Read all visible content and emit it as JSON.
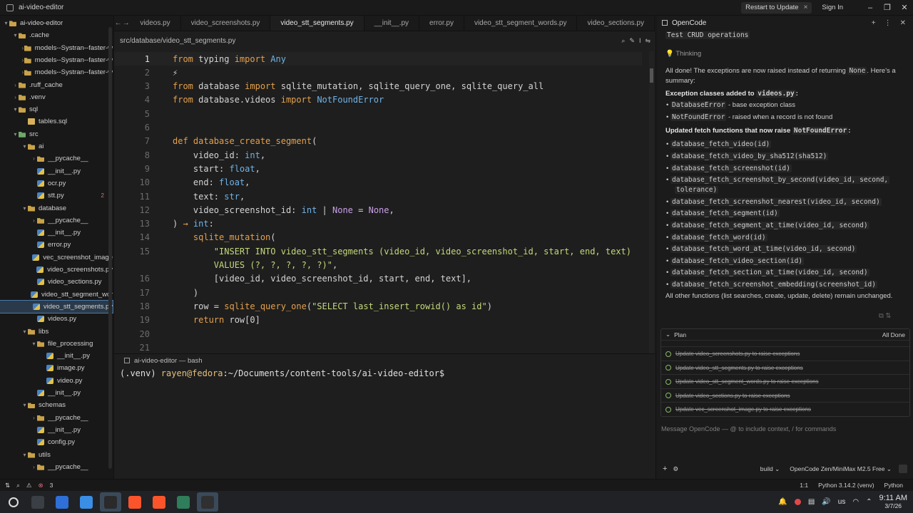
{
  "window": {
    "title": "ai-video-editor",
    "restart_label": "Restart to Update",
    "close_glyph": "×",
    "signin_label": "Sign In",
    "minimize": "–",
    "maximize": "❐",
    "close": "✕"
  },
  "sidebar": {
    "items": [
      {
        "label": "ai-video-editor",
        "icon": "folder",
        "depth": 0,
        "chev": "▾"
      },
      {
        "label": ".cache",
        "icon": "folder",
        "depth": 1,
        "chev": "▾"
      },
      {
        "label": "models--Systran--faster-w",
        "icon": "folder",
        "depth": 2,
        "chev": "›"
      },
      {
        "label": "models--Systran--faster-w",
        "icon": "folder",
        "depth": 2,
        "chev": "›"
      },
      {
        "label": "models--Systran--faster-w",
        "icon": "folder",
        "depth": 2,
        "chev": "›"
      },
      {
        "label": ".ruff_cache",
        "icon": "folder",
        "depth": 1,
        "chev": "›"
      },
      {
        "label": ".venv",
        "icon": "folder",
        "depth": 1,
        "chev": "›"
      },
      {
        "label": "sql",
        "icon": "folder",
        "depth": 1,
        "chev": "▾"
      },
      {
        "label": "tables.sql",
        "icon": "sql",
        "depth": 2,
        "chev": ""
      },
      {
        "label": "src",
        "icon": "folder-green",
        "depth": 1,
        "chev": "▾"
      },
      {
        "label": "ai",
        "icon": "folder",
        "depth": 2,
        "chev": "▾"
      },
      {
        "label": "__pycache__",
        "icon": "folder",
        "depth": 3,
        "chev": "›"
      },
      {
        "label": "__init__.py",
        "icon": "py",
        "depth": 3,
        "chev": ""
      },
      {
        "label": "ocr.py",
        "icon": "py",
        "depth": 3,
        "chev": ""
      },
      {
        "label": "stt.py",
        "icon": "py",
        "depth": 3,
        "chev": "",
        "badge": "2"
      },
      {
        "label": "database",
        "icon": "folder",
        "depth": 2,
        "chev": "▾"
      },
      {
        "label": "__pycache__",
        "icon": "folder",
        "depth": 3,
        "chev": "›"
      },
      {
        "label": "__init__.py",
        "icon": "py",
        "depth": 3,
        "chev": ""
      },
      {
        "label": "error.py",
        "icon": "py",
        "depth": 3,
        "chev": ""
      },
      {
        "label": "vec_screenshot_image",
        "icon": "py",
        "depth": 3,
        "chev": ""
      },
      {
        "label": "video_screenshots.py",
        "icon": "py",
        "depth": 3,
        "chev": ""
      },
      {
        "label": "video_sections.py",
        "icon": "py",
        "depth": 3,
        "chev": ""
      },
      {
        "label": "video_stt_segment_wor",
        "icon": "py",
        "depth": 3,
        "chev": ""
      },
      {
        "label": "video_stt_segments.py",
        "icon": "py",
        "depth": 3,
        "chev": "",
        "active": true
      },
      {
        "label": "videos.py",
        "icon": "py",
        "depth": 3,
        "chev": ""
      },
      {
        "label": "libs",
        "icon": "folder",
        "depth": 2,
        "chev": "▾"
      },
      {
        "label": "file_processing",
        "icon": "folder",
        "depth": 3,
        "chev": "▾"
      },
      {
        "label": "__init__.py",
        "icon": "py",
        "depth": 4,
        "chev": ""
      },
      {
        "label": "image.py",
        "icon": "py",
        "depth": 4,
        "chev": ""
      },
      {
        "label": "video.py",
        "icon": "py",
        "depth": 4,
        "chev": ""
      },
      {
        "label": "__init__.py",
        "icon": "py",
        "depth": 3,
        "chev": ""
      },
      {
        "label": "schemas",
        "icon": "folder",
        "depth": 2,
        "chev": "▾"
      },
      {
        "label": "__pycache__",
        "icon": "folder",
        "depth": 3,
        "chev": "›"
      },
      {
        "label": "__init__.py",
        "icon": "py",
        "depth": 3,
        "chev": ""
      },
      {
        "label": "config.py",
        "icon": "py",
        "depth": 3,
        "chev": ""
      },
      {
        "label": "utils",
        "icon": "folder",
        "depth": 2,
        "chev": "▾"
      },
      {
        "label": "__pycache__",
        "icon": "folder",
        "depth": 3,
        "chev": "›"
      }
    ]
  },
  "tabs": [
    {
      "label": "videos.py",
      "active": false
    },
    {
      "label": "video_screenshots.py",
      "active": false
    },
    {
      "label": "video_stt_segments.py",
      "active": true
    },
    {
      "label": "__init__.py",
      "active": false
    },
    {
      "label": "error.py",
      "active": false
    },
    {
      "label": "video_stt_segment_words.py",
      "active": false
    },
    {
      "label": "video_sections.py",
      "active": false
    }
  ],
  "nav": {
    "back": "←",
    "forward": "→"
  },
  "breadcrumb": {
    "path": "src/database/video_stt_segments.py",
    "tools": [
      "⌕",
      "✎",
      "I",
      "⇋"
    ]
  },
  "editor": {
    "lines": [
      {
        "n": "1",
        "cur": true,
        "toks": [
          [
            "k",
            "from"
          ],
          [
            "p",
            " typing "
          ],
          [
            "k",
            "import"
          ],
          [
            "t",
            " Any"
          ]
        ]
      },
      {
        "n": "2",
        "toks": [
          [
            "p",
            "⚡"
          ]
        ]
      },
      {
        "n": "3",
        "toks": [
          [
            "k",
            "from"
          ],
          [
            "p",
            " database "
          ],
          [
            "k",
            "import"
          ],
          [
            "p",
            " sqlite_mutation, sqlite_query_one, sqlite_query_all"
          ]
        ]
      },
      {
        "n": "4",
        "toks": [
          [
            "k",
            "from"
          ],
          [
            "p",
            " database.videos "
          ],
          [
            "k",
            "import"
          ],
          [
            "t",
            " NotFoundError"
          ]
        ]
      },
      {
        "n": "5",
        "toks": []
      },
      {
        "n": "6",
        "toks": []
      },
      {
        "n": "7",
        "toks": [
          [
            "k",
            "def"
          ],
          [
            "f",
            " database_create_segment"
          ],
          [
            "p",
            "("
          ]
        ]
      },
      {
        "n": "8",
        "toks": [
          [
            "p",
            "    video_id: "
          ],
          [
            "t",
            "int"
          ],
          [
            "p",
            ","
          ]
        ]
      },
      {
        "n": "9",
        "toks": [
          [
            "p",
            "    start: "
          ],
          [
            "t",
            "float"
          ],
          [
            "p",
            ","
          ]
        ]
      },
      {
        "n": "10",
        "toks": [
          [
            "p",
            "    end: "
          ],
          [
            "t",
            "float"
          ],
          [
            "p",
            ","
          ]
        ]
      },
      {
        "n": "11",
        "toks": [
          [
            "p",
            "    text: "
          ],
          [
            "t",
            "str"
          ],
          [
            "p",
            ","
          ]
        ]
      },
      {
        "n": "12",
        "toks": [
          [
            "p",
            "    video_screenshot_id: "
          ],
          [
            "t",
            "int"
          ],
          [
            "p",
            " | "
          ],
          [
            "n",
            "None"
          ],
          [
            "p",
            " = "
          ],
          [
            "n",
            "None"
          ],
          [
            "p",
            ","
          ]
        ]
      },
      {
        "n": "13",
        "toks": [
          [
            "p",
            ") "
          ],
          [
            "k",
            "→"
          ],
          [
            "t",
            " int"
          ],
          [
            "p",
            ":"
          ]
        ]
      },
      {
        "n": "14",
        "toks": [
          [
            "f",
            "    sqlite_mutation"
          ],
          [
            "p",
            "("
          ]
        ]
      },
      {
        "n": "15",
        "toks": [
          [
            "s",
            "        \"INSERT INTO video_stt_segments (video_id, video_screenshot_id, start, end, text)"
          ]
        ]
      },
      {
        "n": "",
        "toks": [
          [
            "s",
            "        VALUES (?, ?, ?, ?, ?)\""
          ],
          [
            "p",
            ","
          ]
        ]
      },
      {
        "n": "16",
        "toks": [
          [
            "p",
            "        [video_id, video_screenshot_id, start, end, text],"
          ]
        ]
      },
      {
        "n": "17",
        "toks": [
          [
            "p",
            "    )"
          ]
        ]
      },
      {
        "n": "18",
        "toks": [
          [
            "p",
            "    row = "
          ],
          [
            "f",
            "sqlite_query_one"
          ],
          [
            "p",
            "("
          ],
          [
            "s",
            "\"SELECT last_insert_rowid() as id\""
          ],
          [
            "p",
            ")"
          ]
        ]
      },
      {
        "n": "19",
        "toks": [
          [
            "k",
            "    return"
          ],
          [
            "p",
            " row[0]"
          ]
        ]
      },
      {
        "n": "20",
        "toks": []
      },
      {
        "n": "21",
        "toks": []
      }
    ]
  },
  "terminal": {
    "tab_label": "ai-video-editor — bash",
    "venv": "(.venv) ",
    "user": "rayen@fedora",
    "path": ":~/Documents/content-tools/ai-video-editor$"
  },
  "panel": {
    "title": "OpenCode",
    "actions": [
      "+",
      "⋮",
      "✕"
    ],
    "task": "Test CRUD operations",
    "thinking": "Thinking",
    "summary_a": "All done! The exceptions are now raised instead of returning ",
    "summary_none": "None",
    "summary_b": ". Here's a",
    "summary_c": "summary:",
    "exc_head_a": "Exception classes added to ",
    "exc_head_file": "videos.py",
    "exc_head_b": ":",
    "exc_items": [
      {
        "code": "DatabaseError",
        "text": " - base exception class"
      },
      {
        "code": "NotFoundError",
        "text": " - raised when a record is not found"
      }
    ],
    "fetch_head_a": "Updated fetch functions that now raise ",
    "fetch_head_code": "NotFoundError",
    "fetch_head_b": ":",
    "fetch_items": [
      "database_fetch_video(id)",
      "database_fetch_video_by_sha512(sha512)",
      "database_fetch_screenshot(id)",
      "database_fetch_screenshot_by_second(video_id, second,",
      "tolerance)",
      "database_fetch_screenshot_nearest(video_id, second)",
      "database_fetch_segment(id)",
      "database_fetch_segment_at_time(video_id, second)",
      "database_fetch_word(id)",
      "database_fetch_word_at_time(video_id, second)",
      "database_fetch_video_section(id)",
      "database_fetch_section_at_time(video_id, second)",
      "database_fetch_screenshot_embedding(screenshot_id)"
    ],
    "closing": "All other functions (list searches, create, update, delete) remain unchanged.",
    "plan_title": "Plan",
    "plan_status": "All Done",
    "plan_items": [
      "Update video_screenshots.py to raise exceptions",
      "Update video_stt_segments.py to raise exceptions",
      "Update video_stt_segment_words.py to raise exceptions",
      "Update video_sections.py to raise exceptions",
      "Update vec_screenshot_image.py to raise exceptions"
    ],
    "placeholder": "Message OpenCode — @ to include context, / for commands",
    "footer_mode": "build",
    "footer_model": "OpenCode Zen/MiniMax M2.5 Free",
    "footer_add": "+",
    "footer_chev": "⌄"
  },
  "statusbar": {
    "left_icons": [
      "⇅",
      "⌕",
      "⚠",
      "⊗"
    ],
    "errors": "3",
    "cursor": "1:1",
    "interpreter": "Python 3.14.2 (venv)",
    "language": "Python"
  },
  "taskbar": {
    "apps": [
      "launcher-icon",
      "terminal-icon",
      "discover-icon",
      "files-icon",
      "editor-icon",
      "brave-icon",
      "brave-alt-icon",
      "monitor-icon",
      "obs-icon"
    ],
    "tray": {
      "lang": "us",
      "time": "9:11 AM",
      "date": "3/7/26"
    }
  },
  "colors": {
    "accent": "#4c7aa8",
    "keyword": "#e5a04c",
    "type": "#6fb3e8",
    "string": "#c4d87a",
    "none": "#c9a0e8"
  }
}
